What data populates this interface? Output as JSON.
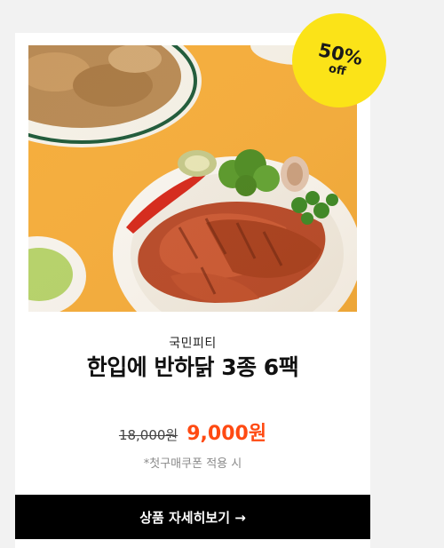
{
  "product": {
    "discount_percent": "50%",
    "discount_off": "off",
    "brand": "국민피티",
    "name": "한입에 반하닭 3종 6팩",
    "original_price": "18,000원",
    "sale_price": "9,000원",
    "coupon_note": "*첫구매쿠폰 적용 시",
    "cta_label": "상품 자세히보기 →"
  },
  "colors": {
    "page_bg": "#f2f2f2",
    "card_bg": "#ffffff",
    "badge": "#fbe318",
    "sale_price": "#ff4a12",
    "cta_bg": "#000000",
    "photo_bg": "#f5ad3c"
  }
}
